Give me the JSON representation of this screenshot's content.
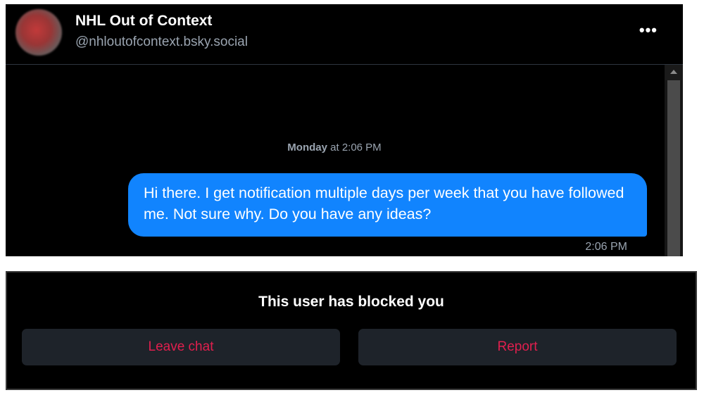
{
  "header": {
    "display_name": "NHL Out of Context",
    "handle": "@nhloutofcontext.bsky.social",
    "more_label": "•••"
  },
  "messages": {
    "date_day": "Monday",
    "date_rest": " at 2:06 PM",
    "items": [
      {
        "text": "Hi there. I get notification multiple days per week that you have followed me. Not sure why. Do you have any ideas?",
        "time": "2:06 PM"
      }
    ]
  },
  "blocked": {
    "title": "This user has blocked you",
    "leave_label": "Leave chat",
    "report_label": "Report"
  },
  "colors": {
    "bubble": "#1184fe",
    "action_text": "#e11f4e",
    "button_bg": "#1e232a"
  }
}
